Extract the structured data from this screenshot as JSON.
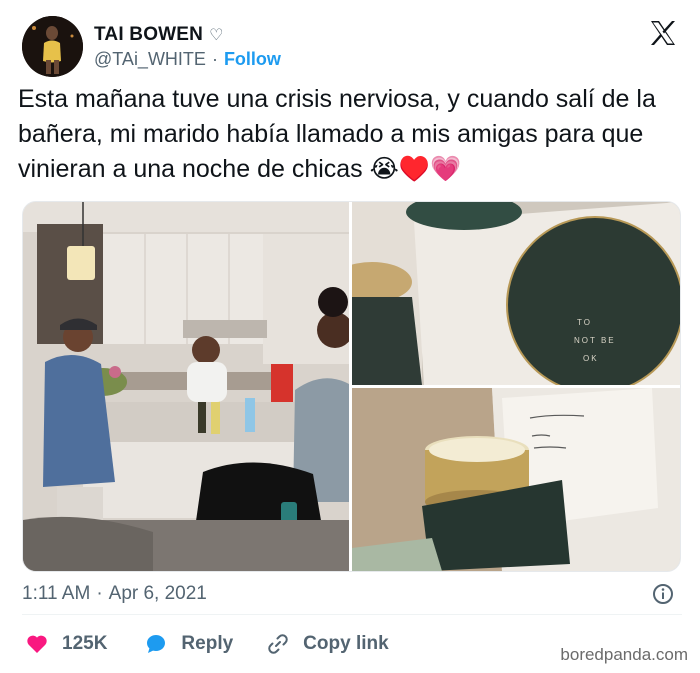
{
  "author": {
    "display_name": "TAI BOWEN",
    "handle": "@TAi_WHITE",
    "separator": "·",
    "follow_label": "Follow"
  },
  "tweet": {
    "text": "Esta mañana tuve una crisis nerviosa, y cuando salí de la bañera, mi marido había llamado a mis amigas para que vinieran a una noche de chicas 😭♥️💗"
  },
  "media": {
    "card_text_1": "TO",
    "card_text_2": "NOT BE",
    "card_text_3": "OK"
  },
  "meta": {
    "time": "1:11 AM",
    "separator": "·",
    "date": "Apr 6, 2021"
  },
  "actions": {
    "like_count": "125K",
    "reply_label": "Reply",
    "copy_label": "Copy link"
  },
  "watermark": "boredpanda.com",
  "colors": {
    "accent": "#1d9bf0",
    "like": "#f91880",
    "text": "#0f1419",
    "muted": "#536471"
  }
}
